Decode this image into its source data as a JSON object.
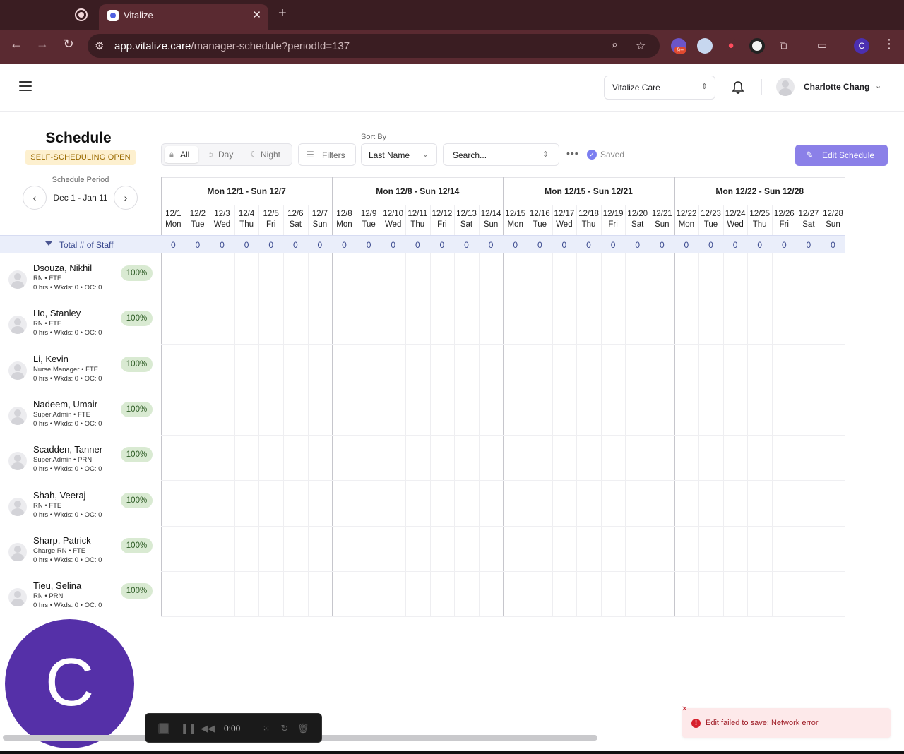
{
  "browser": {
    "tab_title": "Vitalize",
    "url_host": "app.vitalize.care",
    "url_path": "/manager-schedule?periodId=137",
    "ext_badge": "9+",
    "profile_initial": "C"
  },
  "header": {
    "org": "Vitalize Care",
    "user_name": "Charlotte Chang"
  },
  "schedule": {
    "title": "Schedule",
    "badge": "SELF-SCHEDULING OPEN",
    "period_label": "Schedule Period",
    "period_value": "Dec 1 - Jan 11"
  },
  "controls": {
    "segments": [
      "All",
      "Day",
      "Night"
    ],
    "filters": "Filters",
    "sort_by_label": "Sort By",
    "sort_value": "Last Name",
    "search_value": "Search...",
    "saved": "Saved",
    "edit_schedule": "Edit Schedule"
  },
  "weeks": [
    "Mon 12/1 - Sun 12/7",
    "Mon 12/8 - Sun 12/14",
    "Mon 12/15 - Sun 12/21",
    "Mon 12/22 - Sun 12/28"
  ],
  "days": [
    {
      "date": "12/1",
      "dow": "Mon"
    },
    {
      "date": "12/2",
      "dow": "Tue"
    },
    {
      "date": "12/3",
      "dow": "Wed"
    },
    {
      "date": "12/4",
      "dow": "Thu"
    },
    {
      "date": "12/5",
      "dow": "Fri"
    },
    {
      "date": "12/6",
      "dow": "Sat"
    },
    {
      "date": "12/7",
      "dow": "Sun"
    },
    {
      "date": "12/8",
      "dow": "Mon"
    },
    {
      "date": "12/9",
      "dow": "Tue"
    },
    {
      "date": "12/10",
      "dow": "Wed"
    },
    {
      "date": "12/11",
      "dow": "Thu"
    },
    {
      "date": "12/12",
      "dow": "Fri"
    },
    {
      "date": "12/13",
      "dow": "Sat"
    },
    {
      "date": "12/14",
      "dow": "Sun"
    },
    {
      "date": "12/15",
      "dow": "Mon"
    },
    {
      "date": "12/16",
      "dow": "Tue"
    },
    {
      "date": "12/17",
      "dow": "Wed"
    },
    {
      "date": "12/18",
      "dow": "Thu"
    },
    {
      "date": "12/19",
      "dow": "Fri"
    },
    {
      "date": "12/20",
      "dow": "Sat"
    },
    {
      "date": "12/21",
      "dow": "Sun"
    },
    {
      "date": "12/22",
      "dow": "Mon"
    },
    {
      "date": "12/23",
      "dow": "Tue"
    },
    {
      "date": "12/24",
      "dow": "Wed"
    },
    {
      "date": "12/25",
      "dow": "Thu"
    },
    {
      "date": "12/26",
      "dow": "Fri"
    },
    {
      "date": "12/27",
      "dow": "Sat"
    },
    {
      "date": "12/28",
      "dow": "Sun"
    }
  ],
  "totals": {
    "label": "Total # of Staff",
    "values": [
      "0",
      "0",
      "0",
      "0",
      "0",
      "0",
      "0",
      "0",
      "0",
      "0",
      "0",
      "0",
      "0",
      "0",
      "0",
      "0",
      "0",
      "0",
      "0",
      "0",
      "0",
      "0",
      "0",
      "0",
      "0",
      "0",
      "0",
      "0"
    ]
  },
  "staff": [
    {
      "name": "Dsouza, Nikhil",
      "role": "RN • FTE",
      "stats": "0 hrs • Wkds: 0 • OC: 0",
      "pct": "100%"
    },
    {
      "name": "Ho, Stanley",
      "role": "RN • FTE",
      "stats": "0 hrs • Wkds: 0 • OC: 0",
      "pct": "100%"
    },
    {
      "name": "Li, Kevin",
      "role": "Nurse Manager • FTE",
      "stats": "0 hrs • Wkds: 0 • OC: 0",
      "pct": "100%"
    },
    {
      "name": "Nadeem, Umair",
      "role": "Super Admin • FTE",
      "stats": "0 hrs • Wkds: 0 • OC: 0",
      "pct": "100%"
    },
    {
      "name": "Scadden, Tanner",
      "role": "Super Admin • PRN",
      "stats": "0 hrs • Wkds: 0 • OC: 0",
      "pct": "100%"
    },
    {
      "name": "Shah, Veeraj",
      "role": "RN • FTE",
      "stats": "0 hrs • Wkds: 0 • OC: 0",
      "pct": "100%"
    },
    {
      "name": "Sharp, Patrick",
      "role": "Charge RN • FTE",
      "stats": "0 hrs • Wkds: 0 • OC: 0",
      "pct": "100%"
    },
    {
      "name": "Tieu, Selina",
      "role": "RN • PRN",
      "stats": "0 hrs • Wkds: 0 • OC: 0",
      "pct": "100%"
    }
  ],
  "overlay": {
    "avatar_initial": "C",
    "recorder_time": "0:00",
    "toast_message": "Edit failed to save: Network error"
  },
  "colors": {
    "accent": "#8b80e8",
    "badge_bg": "#fdf0cf",
    "pct_bg": "#d9ead2",
    "total_row_bg": "#eaeefa",
    "error": "#d7202d"
  }
}
